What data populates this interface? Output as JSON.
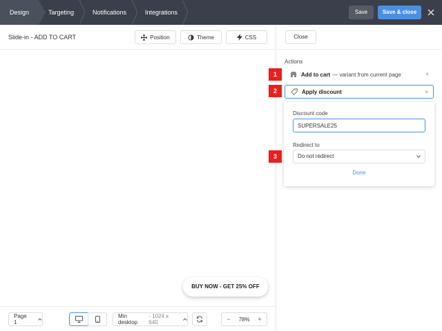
{
  "topbar": {
    "tabs": [
      {
        "label": "Design"
      },
      {
        "label": "Targeting"
      },
      {
        "label": "Notifications"
      },
      {
        "label": "Integrations"
      }
    ],
    "save_label": "Save",
    "save_close_label": "Save & close",
    "close_icon": "close-icon"
  },
  "canvas": {
    "title": "Slide-in - ADD TO CART",
    "tools": {
      "position": "Position",
      "theme": "Theme",
      "css": "CSS"
    },
    "cta_label": "BUY NOW - GET 25% OFF"
  },
  "footer": {
    "page": "Page 1",
    "size_label": "Min desktop",
    "size_value": "- 1024 x 640",
    "zoom": "78%",
    "zoom_minus": "−",
    "zoom_plus": "+"
  },
  "panel": {
    "close_label": "Close",
    "actions_label": "Actions",
    "actions": [
      {
        "title": "Add to cart",
        "subtitle": "— variant from current page"
      },
      {
        "title": "Apply discount",
        "subtitle": ""
      }
    ],
    "remove_glyph": "×",
    "popover": {
      "code_label": "Discount code",
      "code_value": "SUPERSALE25",
      "redirect_label": "Redirect to",
      "redirect_value": "Do not redirect",
      "done_label": "Done"
    }
  },
  "badges": [
    "1",
    "2",
    "3"
  ],
  "colors": {
    "topbar": "#3a3f4b",
    "accent": "#4a90e2",
    "badge": "#e8201f"
  }
}
